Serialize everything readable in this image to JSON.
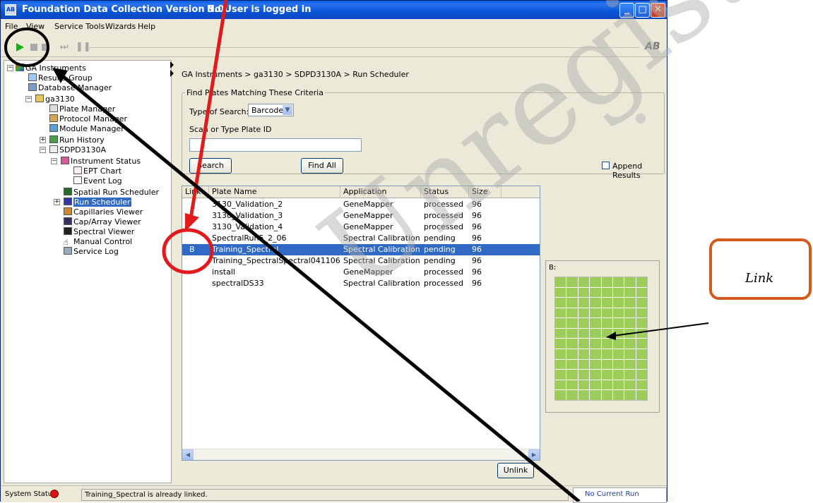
{
  "window": {
    "title": "Foundation Data Collection Version 3.0",
    "separator": "-",
    "user_status": "No User is logged in",
    "min_label": "_",
    "max_label": "□",
    "close_label": "✕",
    "app_icon_label": "AB"
  },
  "menu": [
    "File",
    "View",
    "Service Tools",
    "Wizards",
    "Help"
  ],
  "toolbar": {
    "logo": "AB"
  },
  "tree": {
    "root": "GA Instruments",
    "results_group": "Results Group",
    "database_manager": "Database Manager",
    "instrument": "ga3130",
    "plate_manager": "Plate Manager",
    "protocol_manager": "Protocol Manager",
    "module_manager": "Module Manager",
    "run_history": "Run History",
    "unit": "SDPD3130A",
    "instrument_status": "Instrument Status",
    "ept_chart": "EPT Chart",
    "event_log": "Event Log",
    "spatial_run_scheduler": "Spatial Run Scheduler",
    "run_scheduler": "Run Scheduler",
    "capillaries_viewer": "Capillaries Viewer",
    "cap_array_viewer": "Cap/Array Viewer",
    "spectral_viewer": "Spectral Viewer",
    "manual_control": "Manual Control",
    "service_log": "Service Log"
  },
  "content": {
    "breadcrumb": "GA Instruments > ga3130 > SDPD3130A > Run Scheduler",
    "criteria_legend": "Find Plates Matching These Criteria",
    "type_of_search_label": "Type of Search:",
    "type_of_search_value": "Barcode",
    "scan_label": "Scan or Type Plate ID",
    "plate_id_value": "",
    "search_button": "Search",
    "find_all_button": "Find All",
    "append_results": "Append Results",
    "unlink_button": "Unlink",
    "plate_preview_label": "B:"
  },
  "table": {
    "headers": [
      "Link",
      "Plate Name",
      "Application",
      "Status",
      "Size"
    ],
    "rows": [
      {
        "link": "",
        "name": "3130_Validation_2",
        "app": "GeneMapper",
        "status": "processed",
        "size": "96"
      },
      {
        "link": "",
        "name": "3130_Validation_3",
        "app": "GeneMapper",
        "status": "processed",
        "size": "96"
      },
      {
        "link": "",
        "name": "3130_Validation_4",
        "app": "GeneMapper",
        "status": "processed",
        "size": "96"
      },
      {
        "link": "",
        "name": "SpectralRun5_2_06",
        "app": "Spectral Calibration",
        "status": "pending",
        "size": "96"
      },
      {
        "link": "B",
        "name": "Training_Spectral",
        "app": "Spectral Calibration",
        "status": "pending",
        "size": "96"
      },
      {
        "link": "",
        "name": "Training_SpectralSpectral041106",
        "app": "Spectral Calibration",
        "status": "pending",
        "size": "96"
      },
      {
        "link": "",
        "name": "install",
        "app": "GeneMapper",
        "status": "processed",
        "size": "96"
      },
      {
        "link": "",
        "name": "spectralDS33",
        "app": "Spectral Calibration",
        "status": "processed",
        "size": "96"
      }
    ]
  },
  "status": {
    "label": "System Status",
    "message": "Training_Spectral is already linked.",
    "run": "No Current Run"
  },
  "annotation": {
    "link_text": "Link"
  },
  "watermark": "Unregistered Version",
  "colors": {
    "selection": "#316ac5",
    "well": "#9ccd5a",
    "annotation_red": "#e11b1b",
    "callout_orange": "#d35a1c"
  }
}
